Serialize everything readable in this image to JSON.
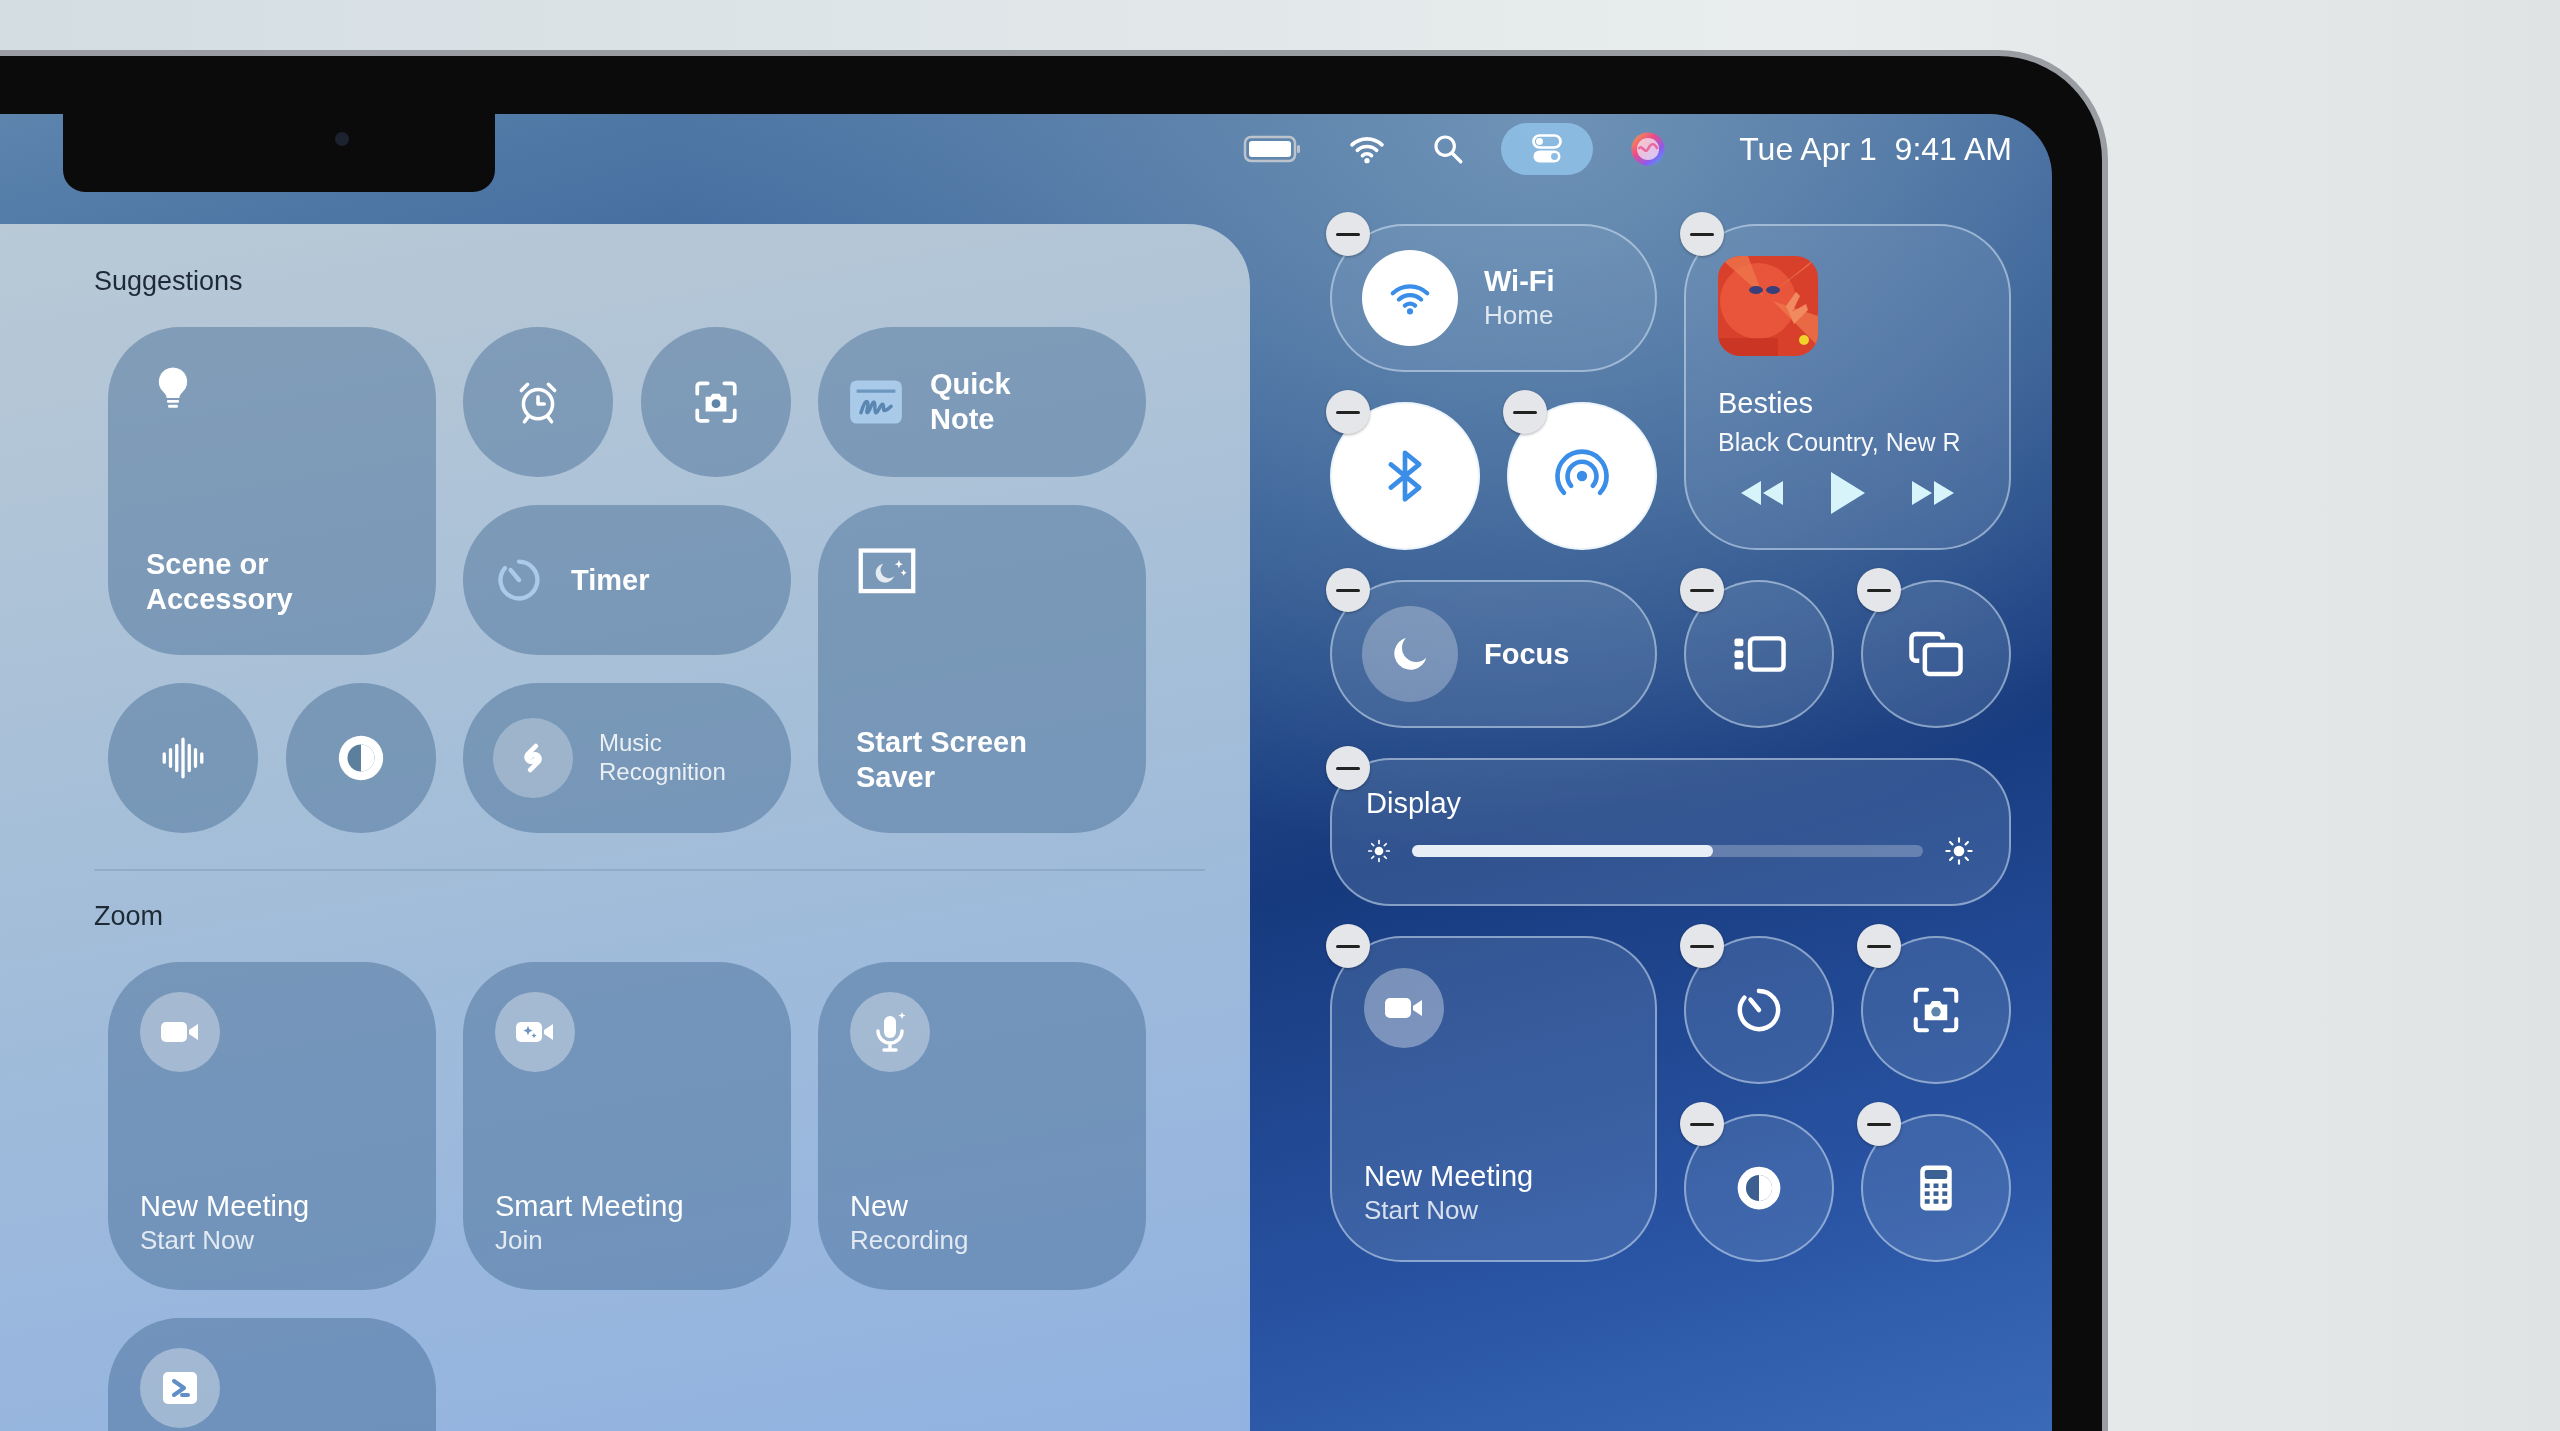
{
  "menu_bar": {
    "status_items": [
      {
        "kind": "battery",
        "selected": false
      },
      {
        "kind": "wifi",
        "selected": false
      },
      {
        "kind": "search",
        "selected": false
      },
      {
        "kind": "control_center",
        "selected": true
      },
      {
        "kind": "siri",
        "selected": false
      }
    ],
    "clock": "Tue Apr 1  9:41 AM"
  },
  "gallery": {
    "sections": [
      {
        "title": "Suggestions",
        "tiles": [
          {
            "kind": "scene",
            "title": "Scene or\nAccessory"
          },
          {
            "kind": "alarm"
          },
          {
            "kind": "screenshot"
          },
          {
            "kind": "quick_note",
            "title": "Quick\nNote"
          },
          {
            "kind": "timer",
            "title": "Timer"
          },
          {
            "kind": "hearing"
          },
          {
            "kind": "dark_mode"
          },
          {
            "kind": "music_recognition",
            "title": "Music\nRecognition"
          },
          {
            "kind": "screen_saver",
            "title": "Start Screen\nSaver"
          }
        ]
      },
      {
        "title": "Zoom",
        "tiles": [
          {
            "kind": "video_meeting",
            "title": "New Meeting",
            "subtitle": "Start Now"
          },
          {
            "kind": "smart_meeting",
            "title": "Smart Meeting",
            "subtitle": "Join"
          },
          {
            "kind": "recording",
            "title": "New",
            "subtitle": "Recording"
          },
          {
            "kind": "zoom_app"
          }
        ]
      }
    ]
  },
  "control_center": {
    "editing": true,
    "controls": [
      {
        "kind": "wifi",
        "title": "Wi-Fi",
        "subtitle": "Home",
        "on": true
      },
      {
        "kind": "now_playing",
        "title": "Besties",
        "subtitle": "Black Country, New R"
      },
      {
        "kind": "bluetooth",
        "on": true
      },
      {
        "kind": "airdrop",
        "on": true
      },
      {
        "kind": "focus",
        "title": "Focus",
        "on": false
      },
      {
        "kind": "stage_manager"
      },
      {
        "kind": "screen_mirroring"
      },
      {
        "kind": "display",
        "title": "Display",
        "level": 0.59
      },
      {
        "kind": "video_meeting",
        "title": "New Meeting",
        "subtitle": "Start Now"
      },
      {
        "kind": "timer"
      },
      {
        "kind": "screenshot"
      },
      {
        "kind": "dark_mode"
      },
      {
        "kind": "calculator"
      }
    ]
  }
}
